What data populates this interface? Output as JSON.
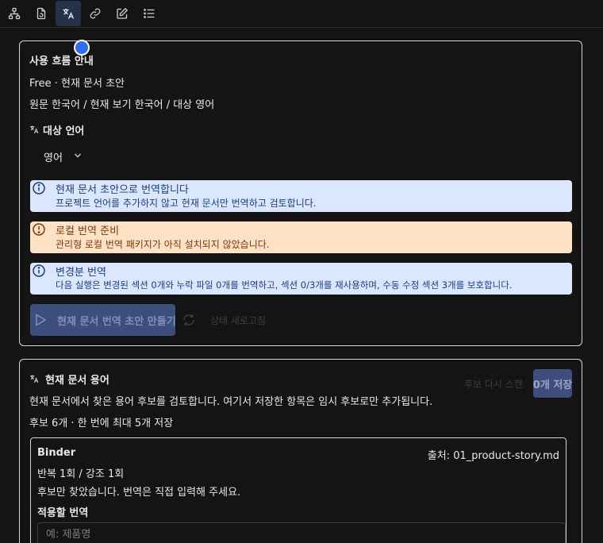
{
  "toolbar": {
    "items": [
      {
        "icon": "sitemap-icon",
        "active": false
      },
      {
        "icon": "file-refresh-icon",
        "active": false
      },
      {
        "icon": "translate-icon",
        "active": true
      },
      {
        "icon": "link-icon",
        "active": false
      },
      {
        "icon": "edit-icon",
        "active": false
      },
      {
        "icon": "list-icon",
        "active": false
      }
    ]
  },
  "flow": {
    "title": "사용 흐름 안내",
    "plan_line": "Free · 현재 문서 초안",
    "language_line": "원문 한국어 / 현재 보기 한국어 / 대상 영어",
    "target_label": "대상 언어",
    "target_value": "영어",
    "banner_current": {
      "title": "현재 문서 초안으로 번역합니다",
      "body": "프로젝트 언어를 추가하지 않고 현재 문서만 번역하고 검토합니다."
    },
    "banner_local": {
      "title": "로컬 번역 준비",
      "body": "관리형 로컬 번역 패키지가 아직 설치되지 않았습니다."
    },
    "banner_diff": {
      "title": "변경분 번역",
      "body": "다음 실행은 변경된 섹션 0개와 누락 파일 0개를 번역하고, 섹션 0/3개를 재사용하며, 수동 수정 섹션 3개를 보호합니다."
    },
    "primary_label": "현재 문서 번역 초안 만들기",
    "refresh_label": "상태 새로고침"
  },
  "terms": {
    "title": "현재 문서 용어",
    "rescan_label": "후보 다시 스캔",
    "save_label": "0개 저장",
    "description": "현재 문서에서 찾은 용어 후보를 검토합니다. 여기서 저장한 항목은 임시 후보로만 추가됩니다.",
    "summary": "후보 6개 · 한 번에 최대 5개 저장",
    "candidate": {
      "term": "Binder",
      "source": "출처: 01_product-story.md",
      "counts": "반복 1회 / 강조 1회",
      "note": "후보만 찾았습니다. 번역은 직접 입력해 주세요.",
      "field_label": "적용할 번역",
      "field_placeholder": "예: 제품명",
      "field_value": ""
    }
  },
  "colors": {
    "info_bg": "#dbe7ff",
    "info_text": "#163e86",
    "warn_bg": "#fde2c6",
    "warn_text": "#8a3404",
    "primary_disabled": "#3c4d7e"
  }
}
